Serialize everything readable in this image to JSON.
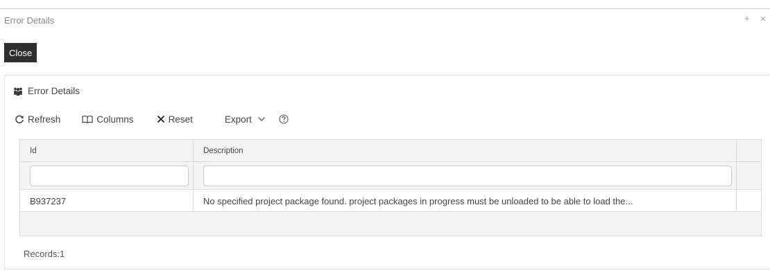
{
  "window": {
    "title": "Error Details",
    "controls": {
      "maximize": "+",
      "close": "×"
    },
    "close_button_label": "Close"
  },
  "panel": {
    "title": "Error Details",
    "icon": "users-icon"
  },
  "toolbar": {
    "refresh": "Refresh",
    "columns": "Columns",
    "reset": "Reset",
    "export": "Export",
    "help_icon": "question-circle-icon"
  },
  "grid": {
    "columns": [
      "Id",
      "Description"
    ],
    "filters": {
      "id": "",
      "description": ""
    },
    "rows": [
      {
        "id": "B937237",
        "description": "No specified project package found. project packages in progress must be unloaded to be able to load the..."
      }
    ]
  },
  "footer": {
    "records": "Records:1"
  }
}
